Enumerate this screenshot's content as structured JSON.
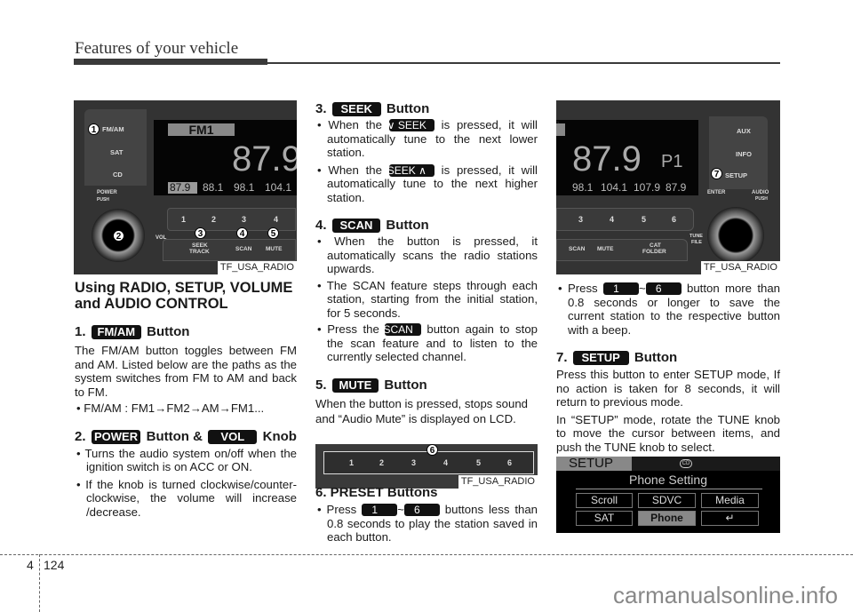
{
  "header": {
    "title": "Features of your vehicle"
  },
  "images": {
    "radio_left": {
      "caption": "TF_USA_RADIO",
      "lcd_band": "FM1",
      "lcd_freq": "87.9",
      "presets": [
        "87.9",
        "88.1",
        "98.1",
        "104.1"
      ],
      "buttons": {
        "fmam": "FM/AM",
        "sat": "SAT",
        "cd": "CD",
        "power": "POWER",
        "push": "PUSH",
        "vol": "VOL",
        "seek1": "SEEK",
        "seek2": "TRACK",
        "scan": "SCAN",
        "mute": "MUTE"
      },
      "preset_btns": [
        "1",
        "2",
        "3",
        "4"
      ],
      "callouts": [
        "1",
        "2",
        "3",
        "4",
        "5"
      ]
    },
    "preset_strip": {
      "caption": "TF_USA_RADIO",
      "buttons": [
        "1",
        "2",
        "3",
        "4",
        "5",
        "6"
      ],
      "callout": "6"
    },
    "radio_right": {
      "caption": "TF_USA_RADIO",
      "lcd_freq": "87.9",
      "lcd_preset": "P1",
      "presets": [
        "98.1",
        "104.1",
        "107.9",
        "87.9"
      ],
      "buttons": {
        "aux": "AUX",
        "info": "INFO",
        "setup": "SETUP",
        "enter": "ENTER",
        "audio": "AUDIO",
        "push": "PUSH",
        "tune": "TUNE",
        "file": "FILE",
        "scan": "SCAN",
        "mute": "MUTE",
        "cat": "CAT",
        "folder": "FOLDER"
      },
      "preset_btns": [
        "3",
        "4",
        "5",
        "6"
      ],
      "callout": "7"
    },
    "setup_lcd": {
      "mode": "SETUP",
      "cd_icon": "CD",
      "title": "Phone Setting",
      "items": [
        "Scroll",
        "SDVC",
        "Media",
        "SAT",
        "Phone",
        "↵"
      ],
      "selected": "Phone"
    }
  },
  "col1": {
    "heading": "Using RADIO, SETUP, VOLUME and AUDIO CONTROL",
    "s1_num": "1.",
    "s1_tag": "FM/AM",
    "s1_word": "Button",
    "s1_text": "The FM/AM button toggles between FM and AM. Listed below are the paths as the system switches from FM to AM and back to FM.",
    "s1_bullet": "FM/AM : FM1→FM2→AM→FM1...",
    "s2_num": "2.",
    "s2_tag1": "POWER",
    "s2_mid": "Button &",
    "s2_tag2": "VOL",
    "s2_word": "Knob",
    "s2_b1": "Turns the audio system on/off when the ignition switch is on ACC or ON.",
    "s2_b2": "If the knob is turned clockwise/counter-clockwise, the volume will increase /decrease."
  },
  "col2": {
    "s3_num": "3.",
    "s3_tag": "SEEK",
    "s3_word": "Button",
    "s3_b1_pre": "When the",
    "s3_b1_tag": "∨ SEEK",
    "s3_b1_post": "is pressed, it will automatically tune to the next lower station.",
    "s3_b2_pre": "When the",
    "s3_b2_tag": "SEEK ∧",
    "s3_b2_post": "is pressed, it will automatically tune to the next higher station.",
    "s4_num": "4.",
    "s4_tag": "SCAN",
    "s4_word": "Button",
    "s4_b1": "When the button is pressed, it automatically scans the radio stations upwards.",
    "s4_b2": "The SCAN feature steps through each station, starting from the initial station, for 5 seconds.",
    "s4_b3_pre": "Press the",
    "s4_b3_tag": "SCAN",
    "s4_b3_post": "button again to stop the scan feature and to listen to the currently selected channel.",
    "s5_num": "5.",
    "s5_tag": "MUTE",
    "s5_word": "Button",
    "s5_text": "When the button is pressed, stops sound and “Audio Mute” is displayed on LCD.",
    "s6_heading": "6. PRESET Buttons",
    "s6_b1_pre": "Press",
    "s6_tag1": "1",
    "s6_tilde": "~",
    "s6_tag2": "6",
    "s6_b1_post": "buttons less than 0.8 seconds to play the station saved in each button."
  },
  "col3": {
    "b1_pre": "Press",
    "tag1": "1",
    "tilde": "~",
    "tag2": "6",
    "b1_post": "button more than 0.8 seconds or longer to save the current station to the respective button with a beep.",
    "s7_num": "7.",
    "s7_tag": "SETUP",
    "s7_word": "Button",
    "p1": "Press this button to enter SETUP mode, If no action is taken for 8 seconds, it will return to previous mode.",
    "p2": "In “SETUP” mode, rotate the TUNE knob to move the cursor between items, and push the TUNE knob to select."
  },
  "footer": {
    "section": "4",
    "page": "124",
    "watermark": "carmanualsonline.info"
  }
}
